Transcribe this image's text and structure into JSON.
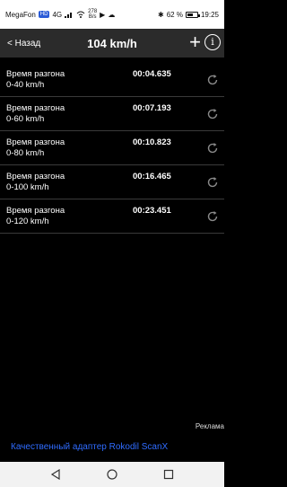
{
  "status_bar": {
    "carrier": "MegaFon",
    "network_badge": "HD",
    "signal": "4G",
    "speed_value": "278",
    "speed_unit": "B/s",
    "battery_percent": "62 %",
    "time": "19:25"
  },
  "top_bar": {
    "back_label": "< Назад",
    "title": "104 km/h",
    "add_icon": "plus-icon",
    "info_icon": "info-icon"
  },
  "results": [
    {
      "label_line1": "Время разгона",
      "label_line2": "0-40 km/h",
      "time": "00:04.635"
    },
    {
      "label_line1": "Время разгона",
      "label_line2": "0-60 km/h",
      "time": "00:07.193"
    },
    {
      "label_line1": "Время разгона",
      "label_line2": "0-80 km/h",
      "time": "00:10.823"
    },
    {
      "label_line1": "Время разгона",
      "label_line2": "0-100 km/h",
      "time": "00:16.465"
    },
    {
      "label_line1": "Время разгона",
      "label_line2": "0-120 km/h",
      "time": "00:23.451"
    }
  ],
  "ad": {
    "label": "Реклама",
    "text": "Качественный адаптер Rokodil ScanX"
  },
  "colors": {
    "top_bar_bg": "#2b2b2b",
    "background": "#000000",
    "ad_link": "#2f6cff"
  }
}
